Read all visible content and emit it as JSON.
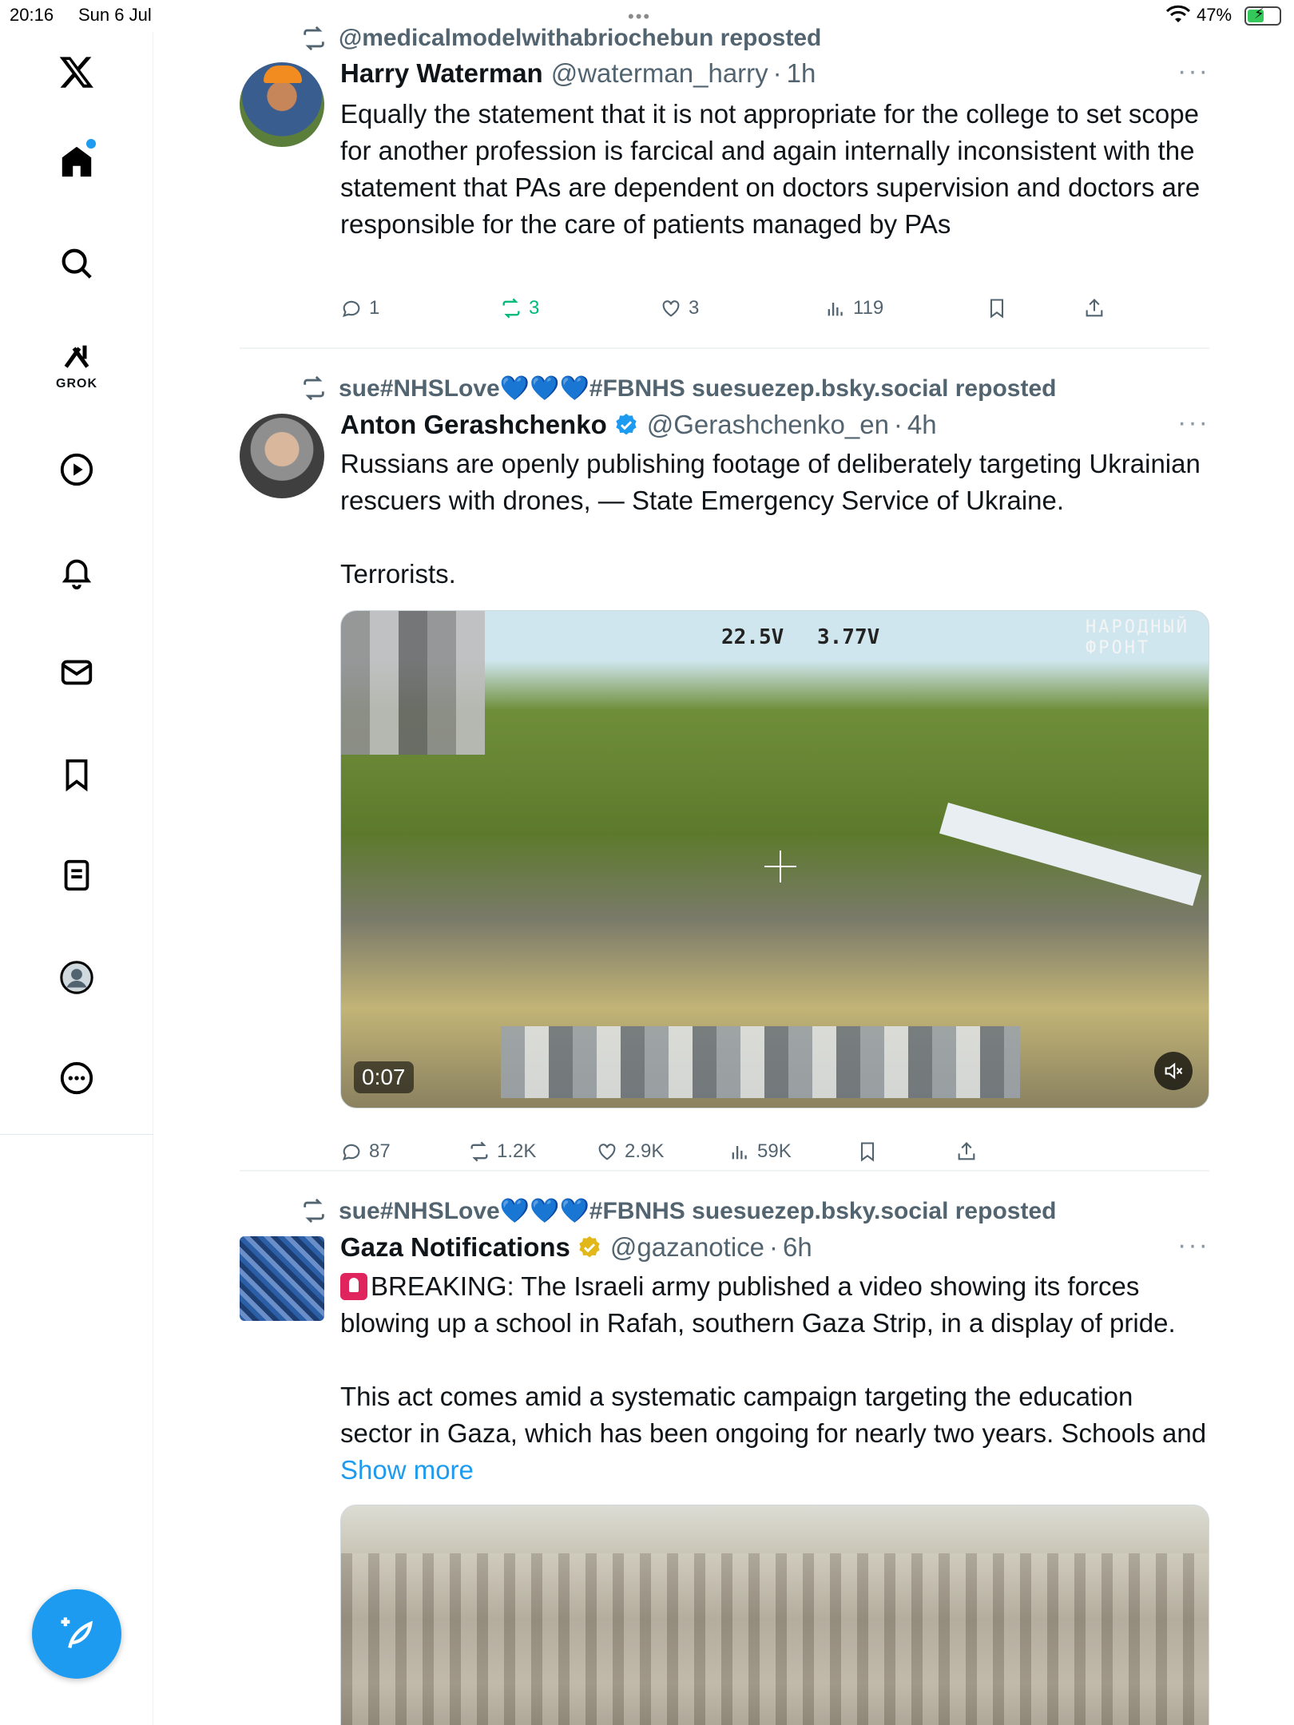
{
  "status_bar": {
    "time": "20:16",
    "date": "Sun 6 Jul",
    "battery_pct": "47%"
  },
  "sidebar": {
    "items": [
      {
        "name": "x-logo",
        "label": ""
      },
      {
        "name": "home",
        "label": ""
      },
      {
        "name": "search",
        "label": ""
      },
      {
        "name": "grok",
        "label": "GROK"
      },
      {
        "name": "video",
        "label": ""
      },
      {
        "name": "notifications",
        "label": ""
      },
      {
        "name": "messages",
        "label": ""
      },
      {
        "name": "bookmarks",
        "label": ""
      },
      {
        "name": "lists",
        "label": ""
      },
      {
        "name": "profile",
        "label": ""
      },
      {
        "name": "more",
        "label": ""
      }
    ]
  },
  "feed": {
    "tweets": [
      {
        "repost_by": "@medicalmodelwithabriochebun reposted",
        "name": "Harry Waterman",
        "verified": false,
        "handle": "@waterman_harry",
        "age": "1h",
        "paragraphs": [
          "Equally the statement that it is not appropriate for the college to set scope for another profession is farcical and again internally inconsistent with the statement that PAs are dependent on doctors supervision and doctors are responsible for the care of patients managed by PAs"
        ],
        "replies": "1",
        "reposts": "3",
        "likes": "3",
        "views": "119"
      },
      {
        "repost_by": "sue#NHSLove💙💙💙#FBNHS suesuezep.bsky.social reposted",
        "name": "Anton Gerashchenko",
        "verified": true,
        "handle": "@Gerashchenko_en",
        "age": "4h",
        "paragraphs": [
          "Russians are openly publishing footage of deliberately targeting Ukrainian rescuers with drones, — State Emergency Service of Ukraine.",
          "Terrorists."
        ],
        "video": {
          "duration": "0:07",
          "osd_left": "22.5V",
          "osd_right": "3.77V",
          "watermark": "НАРОДНЫЙ ФРОНТ"
        },
        "replies": "87",
        "reposts": "1.2K",
        "likes": "2.9K",
        "views": "59K"
      },
      {
        "repost_by": "sue#NHSLove💙💙💙#FBNHS suesuezep.bsky.social reposted",
        "name": "Gaza Notifications",
        "verified": true,
        "verified_color": "#e2b719",
        "handle": "@gazanotice",
        "age": "6h",
        "paragraph1": "BREAKING: The Israeli army published a video showing its forces blowing up a school in Rafah, southern Gaza Strip, in a display of pride.",
        "paragraph2": "This act comes amid a systematic campaign targeting the education sector in Gaza, which has been ongoing for nearly two years. Schools and",
        "show_more": "Show more"
      }
    ]
  },
  "colors": {
    "accent": "#1d9bf0",
    "repost_green": "#00ba7c",
    "muted": "#536471"
  }
}
